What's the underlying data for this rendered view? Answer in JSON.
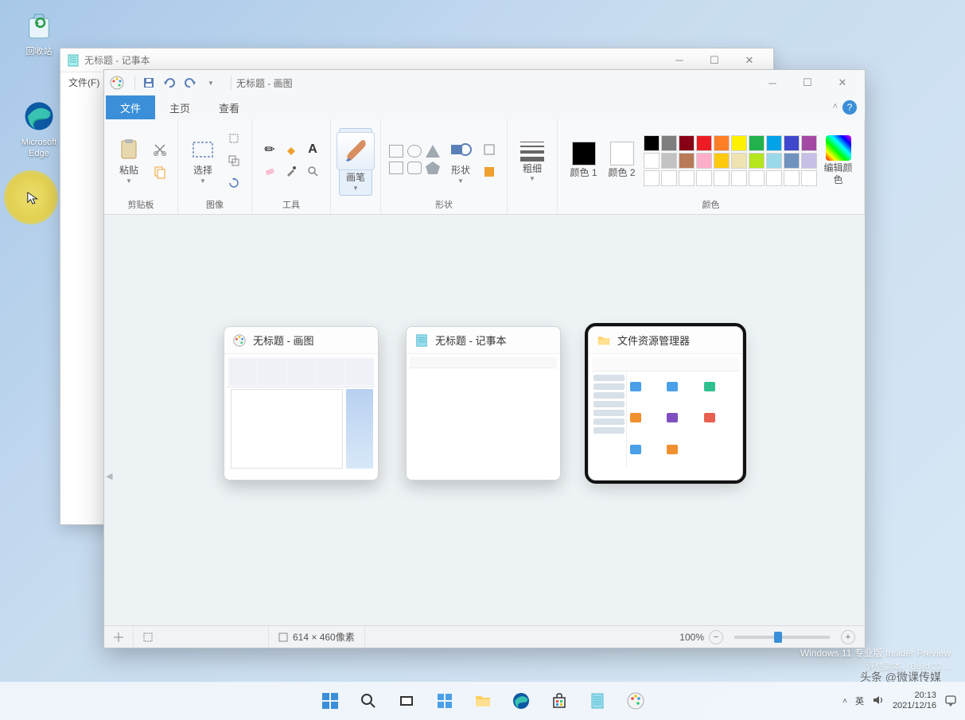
{
  "desktop": {
    "recycle_bin": "回收站",
    "edge": "Microsoft Edge"
  },
  "notepad": {
    "title": "无标题 - 记事本",
    "menu_file": "文件(F)"
  },
  "paint": {
    "title": "无标题 - 画图",
    "tabs": {
      "file": "文件",
      "home": "主页",
      "view": "查看"
    },
    "ribbon": {
      "paste": "粘贴",
      "clipboard": "剪贴板",
      "select": "选择",
      "image": "图像",
      "tools": "工具",
      "brush": "画笔",
      "shapes": "形状",
      "shapes_big": "形状",
      "size": "粗细",
      "color1": "颜色 1",
      "color2": "颜色 2",
      "colors": "颜色",
      "edit_colors": "编辑颜色"
    },
    "swatches_row1": [
      "#000000",
      "#7f7f7f",
      "#880015",
      "#ed1c24",
      "#ff7f27",
      "#fff200",
      "#22b14c",
      "#00a2e8",
      "#3f48cc",
      "#a349a4"
    ],
    "swatches_row2": [
      "#ffffff",
      "#c3c3c3",
      "#b97a57",
      "#ffaec9",
      "#ffc90e",
      "#efe4b0",
      "#b5e61d",
      "#99d9ea",
      "#7092be",
      "#c8bfe7"
    ],
    "swatches_row3": [
      "#ffffff",
      "#ffffff",
      "#ffffff",
      "#ffffff",
      "#ffffff",
      "#ffffff",
      "#ffffff",
      "#ffffff",
      "#ffffff",
      "#ffffff"
    ],
    "status": {
      "dimensions": "614 × 460像素",
      "zoom": "100%"
    }
  },
  "alttab": {
    "paint": "无标题 - 画图",
    "notepad": "无标题 - 记事本",
    "explorer": "文件资源管理器"
  },
  "os": {
    "line1": "Windows 11 专业版 Insider Preview",
    "line2": "评估副本。Build 22…",
    "time": "20:13",
    "date": "2021/12/16",
    "ime": "英"
  },
  "watermark": "头条 @微课传媒"
}
